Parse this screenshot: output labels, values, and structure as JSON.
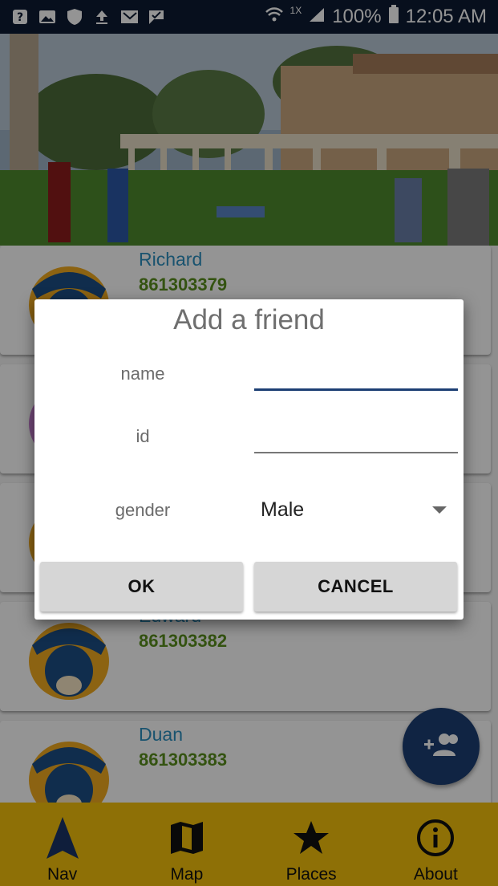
{
  "status_bar": {
    "network_label": "1X",
    "battery": "100%",
    "time": "12:05 AM",
    "icons": [
      "help-icon",
      "image-icon",
      "shield-icon",
      "upload-icon",
      "mail-icon",
      "check-flag-icon",
      "wifi-icon",
      "signal-icon",
      "battery-icon"
    ]
  },
  "friends": [
    {
      "name": "Richard",
      "id": "861303379"
    },
    {
      "name": "",
      "id": ""
    },
    {
      "name": "",
      "id": ""
    },
    {
      "name": "Edward",
      "id": "861303382"
    },
    {
      "name": "Duan",
      "id": "861303383"
    }
  ],
  "dialog": {
    "title": "Add a friend",
    "name_label": "name",
    "id_label": "id",
    "gender_label": "gender",
    "name_value": "",
    "id_value": "",
    "gender_value": "Male",
    "ok_label": "OK",
    "cancel_label": "CANCEL"
  },
  "fab": {
    "icon": "add-friend-icon"
  },
  "bottom_nav": {
    "items": [
      {
        "label": "Nav",
        "icon": "navigation-arrow-icon"
      },
      {
        "label": "Map",
        "icon": "map-icon"
      },
      {
        "label": "Places",
        "icon": "star-icon"
      },
      {
        "label": "About",
        "icon": "info-icon"
      }
    ]
  },
  "colors": {
    "status_bar": "#0d1b33",
    "nav_bar": "#f5c20c",
    "fab": "#1d3f74",
    "friend_name": "#2c8fbf",
    "friend_id": "#5a8f1e",
    "input_focus": "#1d3f74"
  }
}
